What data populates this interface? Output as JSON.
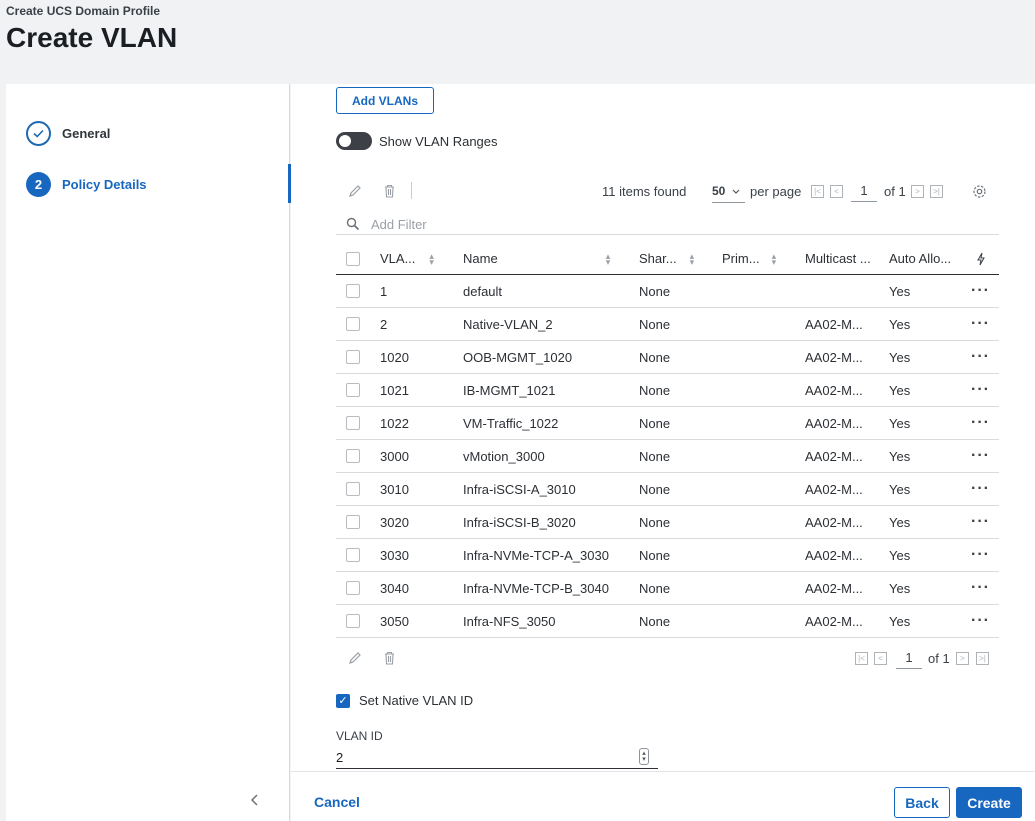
{
  "header": {
    "breadcrumb": "Create UCS Domain Profile",
    "title": "Create VLAN"
  },
  "steps": [
    {
      "number": "",
      "label": "General",
      "state": "done"
    },
    {
      "number": "2",
      "label": "Policy Details",
      "state": "active"
    }
  ],
  "main": {
    "add_vlans_label": "Add VLANs",
    "show_ranges_label": "Show VLAN Ranges",
    "show_ranges_on": false,
    "toolbar": {
      "items_found": "11 items found",
      "per_page_value": "50",
      "per_page_label": "per page",
      "page": "1",
      "of_label": "of 1"
    },
    "filter_placeholder": "Add Filter",
    "table": {
      "columns": [
        "VLA...",
        "Name",
        "Shar...",
        "Prim...",
        "Multicast ...",
        "Auto Allo..."
      ],
      "rows": [
        {
          "vlan": "1",
          "name": "default",
          "sharing": "None",
          "primary": "",
          "multicast": "",
          "auto": "Yes"
        },
        {
          "vlan": "2",
          "name": "Native-VLAN_2",
          "sharing": "None",
          "primary": "",
          "multicast": "AA02-M...",
          "auto": "Yes"
        },
        {
          "vlan": "1020",
          "name": "OOB-MGMT_1020",
          "sharing": "None",
          "primary": "",
          "multicast": "AA02-M...",
          "auto": "Yes"
        },
        {
          "vlan": "1021",
          "name": "IB-MGMT_1021",
          "sharing": "None",
          "primary": "",
          "multicast": "AA02-M...",
          "auto": "Yes"
        },
        {
          "vlan": "1022",
          "name": "VM-Traffic_1022",
          "sharing": "None",
          "primary": "",
          "multicast": "AA02-M...",
          "auto": "Yes"
        },
        {
          "vlan": "3000",
          "name": "vMotion_3000",
          "sharing": "None",
          "primary": "",
          "multicast": "AA02-M...",
          "auto": "Yes"
        },
        {
          "vlan": "3010",
          "name": "Infra-iSCSI-A_3010",
          "sharing": "None",
          "primary": "",
          "multicast": "AA02-M...",
          "auto": "Yes"
        },
        {
          "vlan": "3020",
          "name": "Infra-iSCSI-B_3020",
          "sharing": "None",
          "primary": "",
          "multicast": "AA02-M...",
          "auto": "Yes"
        },
        {
          "vlan": "3030",
          "name": "Infra-NVMe-TCP-A_3030",
          "sharing": "None",
          "primary": "",
          "multicast": "AA02-M...",
          "auto": "Yes"
        },
        {
          "vlan": "3040",
          "name": "Infra-NVMe-TCP-B_3040",
          "sharing": "None",
          "primary": "",
          "multicast": "AA02-M...",
          "auto": "Yes"
        },
        {
          "vlan": "3050",
          "name": "Infra-NFS_3050",
          "sharing": "None",
          "primary": "",
          "multicast": "AA02-M...",
          "auto": "Yes"
        }
      ]
    },
    "footer_pagination": {
      "page": "1",
      "of_label": "of 1"
    },
    "native_vlan": {
      "label": "Set Native VLAN ID",
      "checked": true
    },
    "vlan_id": {
      "label": "VLAN ID",
      "value": "2"
    }
  },
  "actions": {
    "cancel_label": "Cancel",
    "back_label": "Back",
    "create_label": "Create"
  },
  "colors": {
    "accent": "#1767c0",
    "background": "#f1f2f4"
  }
}
